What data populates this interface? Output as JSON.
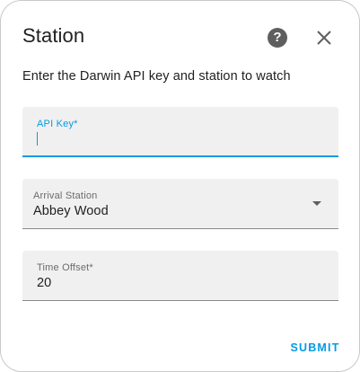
{
  "dialog": {
    "title": "Station",
    "description": "Enter the Darwin API key and station to watch",
    "help_icon": "question-circle-icon",
    "close_icon": "close-icon"
  },
  "form": {
    "api_key": {
      "label": "API Key*",
      "value": "",
      "state": "focused"
    },
    "arrival_station": {
      "label": "Arrival Station",
      "value": "Abbey Wood",
      "dropdown_icon": "chevron-down-icon"
    },
    "time_offset": {
      "label": "Time Offset*",
      "value": "20"
    }
  },
  "actions": {
    "submit_label": "SUBMIT"
  },
  "colors": {
    "accent": "#039be5",
    "field_background": "#f0f0f0",
    "text_primary": "#212121",
    "text_secondary": "#6b6b6b",
    "icon": "#5f5f5f"
  }
}
